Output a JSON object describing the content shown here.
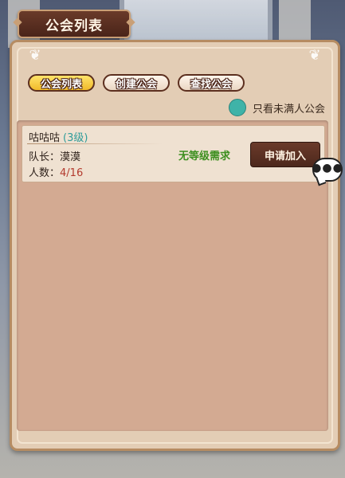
{
  "title": "公会列表",
  "tabs": [
    {
      "label": "公会列表",
      "active": true
    },
    {
      "label": "创建公会",
      "active": false
    },
    {
      "label": "查找公会",
      "active": false
    }
  ],
  "filter": {
    "label": "只看未满人公会",
    "color": "#3fb3a8"
  },
  "guilds": [
    {
      "name": "咕咕咕",
      "level": "(3级)",
      "leader_label": "队长：",
      "leader": "漠漠",
      "members_label": "人数：",
      "members": "4/16",
      "requirement": "无等级需求",
      "apply_label": "申请加入"
    }
  ],
  "chat_icon": "speech-bubble-ellipsis-icon",
  "colors": {
    "accent": "#f0b92a",
    "level": "#2f9c9a",
    "requirement": "#3d8f1f",
    "members": "#b33a2e"
  }
}
